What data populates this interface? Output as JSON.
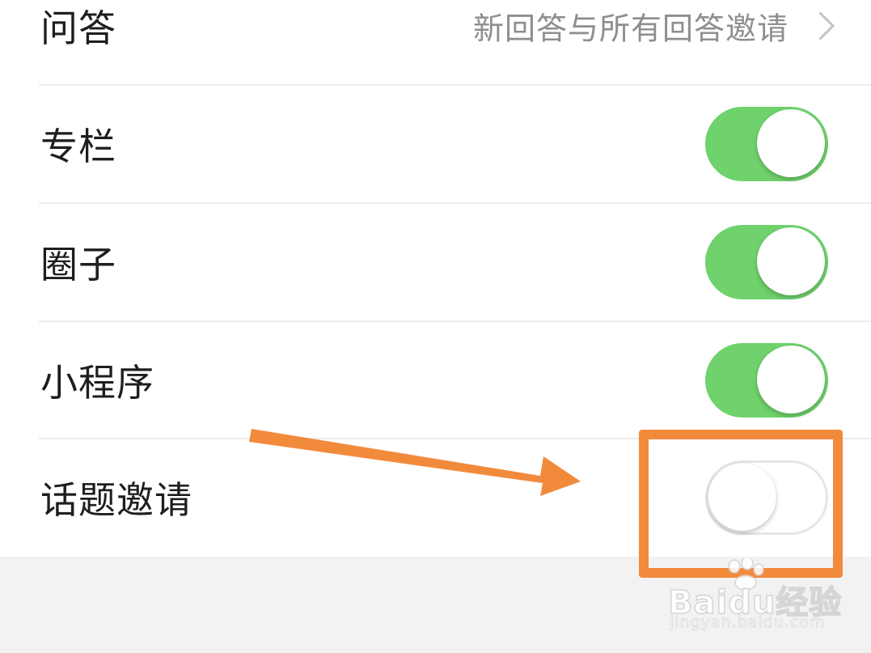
{
  "settings": {
    "rows": [
      {
        "label": "问答",
        "value": "新回答与所有回答邀请"
      },
      {
        "label": "专栏",
        "toggle": true
      },
      {
        "label": "圈子",
        "toggle": true
      },
      {
        "label": "小程序",
        "toggle": true
      },
      {
        "label": "话题邀请",
        "toggle": false
      }
    ]
  },
  "colors": {
    "toggle_on": "#6fd26c",
    "toggle_off": "#ffffff",
    "annotation": "#f28a3c",
    "background": "#f2f2f3"
  },
  "icons": {
    "chevron": "chevron-right-icon",
    "arrow": "annotation-arrow-icon"
  },
  "watermark": {
    "logo": "Baidu经验",
    "url": "jingyan.baidu.com"
  }
}
